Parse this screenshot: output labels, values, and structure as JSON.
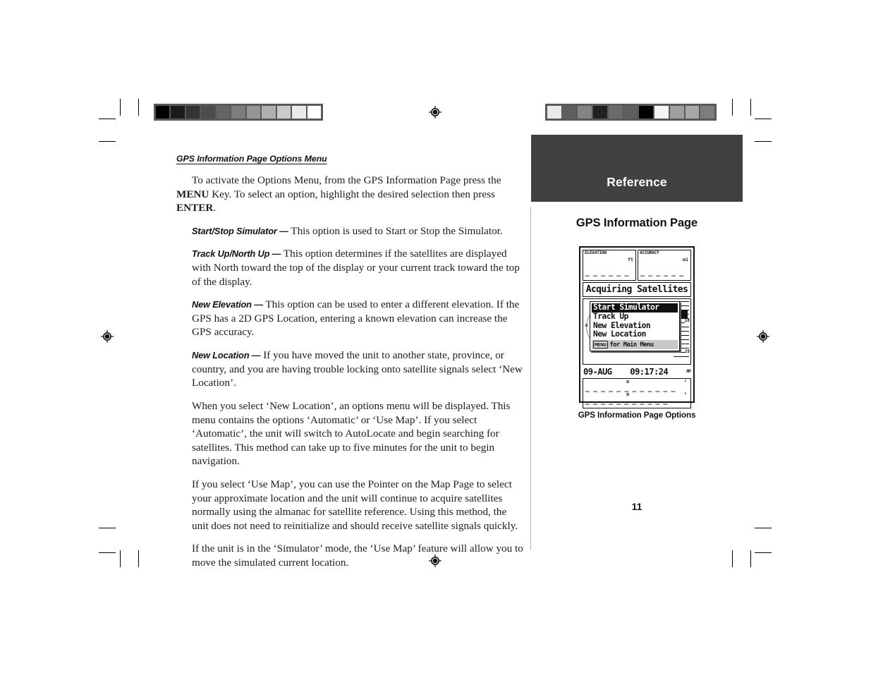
{
  "document": {
    "page_number": "11",
    "section_heading": "GPS Information Page Options Menu",
    "intro_paragraph_part1": "To activate the Options Menu, from the GPS Information Page press the ",
    "intro_key_menu": "MENU",
    "intro_paragraph_part2": " Key. To select an option, highlight the desired selection then press ",
    "intro_key_enter": "ENTER",
    "intro_paragraph_part3": ".",
    "options": [
      {
        "name": "Start/Stop Simulator —",
        "description": " This option is used to Start or Stop the Simulator."
      },
      {
        "name": "Track Up/North Up —",
        "description": " This option determines if the satellites are displayed with North toward the top of the display or your current track toward the top of the display."
      },
      {
        "name": "New Elevation —",
        "description": " This option can be used to enter a different elevation.  If the GPS has a 2D GPS Location, entering a known elevation can increase the GPS accuracy."
      },
      {
        "name": "New Location —",
        "description": "  If you have moved the unit to another state, province, or country, and you are having trouble locking onto satellite signals select ‘New Location’."
      }
    ],
    "paragraphs": [
      "When you select ‘New Location’, an options menu will be displayed.  This menu contains the options ‘Automatic’ or ‘Use Map’.  If you select ‘Automatic’, the unit will switch to AutoLocate and begin searching for satellites. This method can take up to five minutes for the unit to begin navigation.",
      "If you select ‘Use Map’, you can use the Pointer on the Map Page to select your approximate location and the unit will continue to acquire satellites normally using the almanac for satellite reference.  Using this method, the unit does not need to reinitialize and should receive satellite signals quickly.",
      "If the unit is in the ‘Simulator’ mode, the ‘Use Map’ feature will allow you to move the simulated current location."
    ]
  },
  "sidebar": {
    "band_label": "Reference",
    "band_color": "#414141",
    "title": "GPS Information Page",
    "figure_caption": "GPS Information Page Options"
  },
  "gps_screen": {
    "elevation_label": "ELEVATION",
    "elevation_units": "ft",
    "elevation_value": "_ _ _ _ _ _",
    "accuracy_label": "ACCURACY",
    "accuracy_units": "mi",
    "accuracy_value": "_ _ _ _ _ _",
    "status_text": "Acquiring Satellites",
    "menu_items": [
      {
        "label": "Start Simulator",
        "selected": true
      },
      {
        "label": "Track Up",
        "selected": false
      },
      {
        "label": "New Elevation",
        "selected": false
      },
      {
        "label": "New Location",
        "selected": false
      }
    ],
    "menu_footer_key": "MENU",
    "menu_footer_text": "for Main Menu",
    "date": "09-AUG",
    "time": "09:17:24",
    "time_ampm": "AM",
    "satellites": [
      {
        "id": "18"
      },
      {
        "id": "29"
      }
    ],
    "sky_ticks": [
      "2",
      "W",
      "2"
    ],
    "coord_lat": "_ _  _ _ _ _  _ _ _ _ _ _",
    "coord_lon": "_ _ _ _ _  _ _ _ _ _ _",
    "coord_symbol_1": "'",
    "coord_symbol_2": "'",
    "coord_deg_1": "o",
    "coord_deg_2": "o"
  },
  "print_marks": {
    "left_calibration_swatches": [
      "#000000",
      "#1b1b1b",
      "#333333",
      "#4c4c4c",
      "#646464",
      "#7d7d7d",
      "#969696",
      "#b0b0b0",
      "#cacaca",
      "#eaeaea",
      "#ffffff"
    ],
    "right_calibration_swatches": [
      "#e9e9e9",
      "#5e5e5e",
      "#848484",
      "#212121",
      "#6b6b6b",
      "#5e5e5e",
      "#000000",
      "#f4f4f4",
      "#9f9f9f",
      "#a8a8a8",
      "#7d7d7d"
    ],
    "registration_icon": "registration-target"
  }
}
